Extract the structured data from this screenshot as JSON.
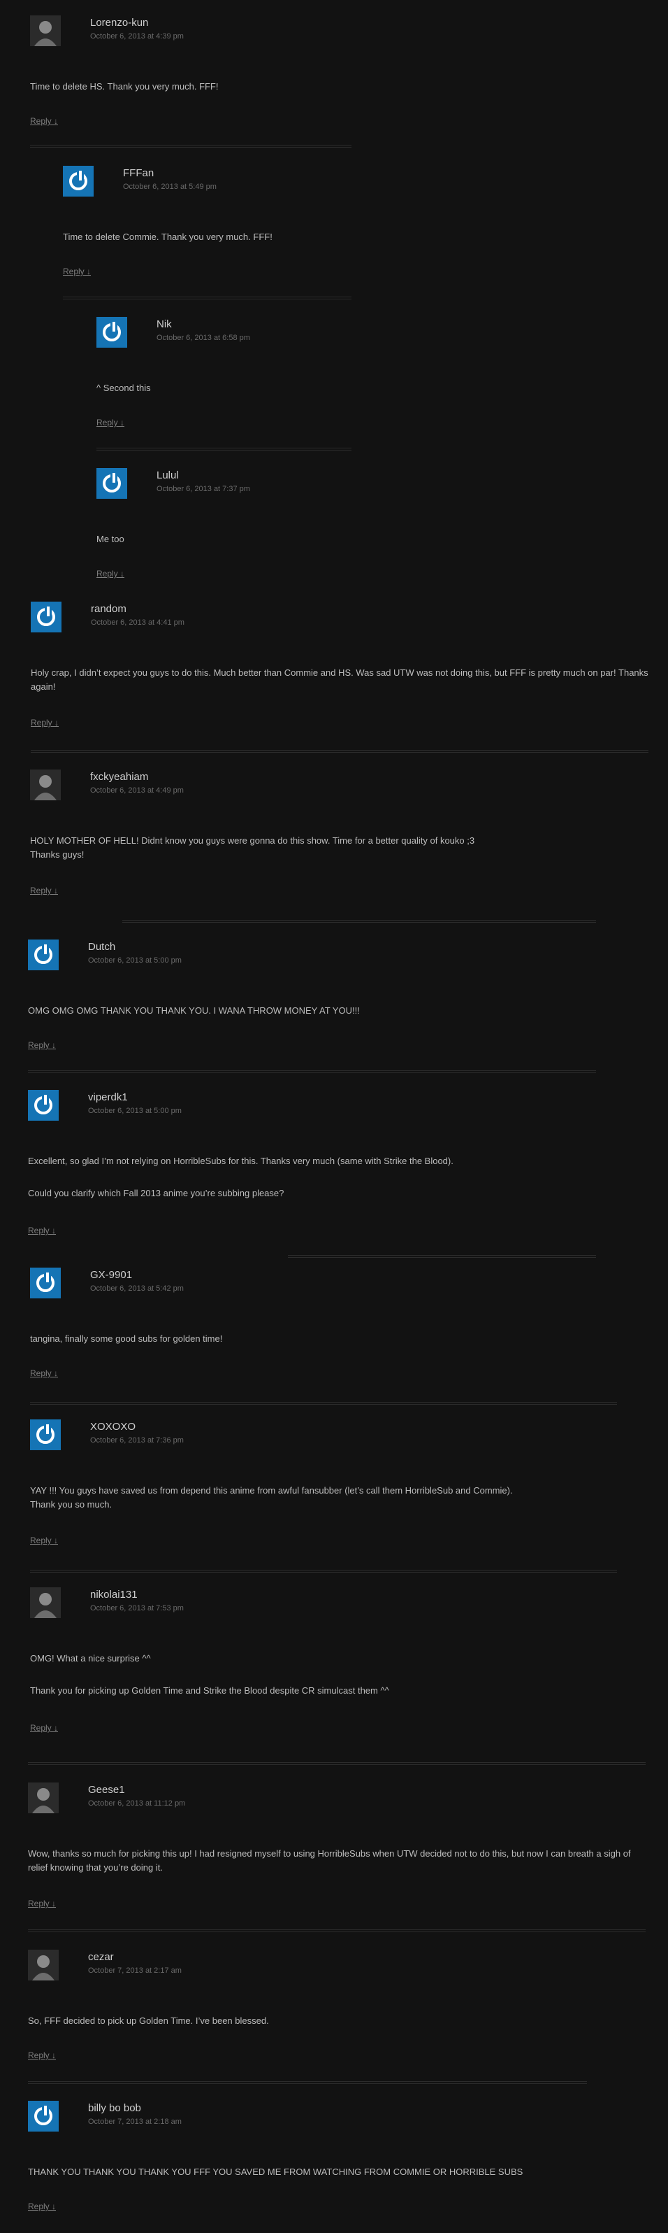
{
  "reply_label": "Reply ↓",
  "comments": [
    {
      "author": "Lorenzo-kun",
      "date": "October 6, 2013 at 4:39 pm",
      "paragraphs": [
        "Time to delete HS. Thank you very much. FFF!"
      ]
    },
    {
      "author": "FFFan",
      "date": "October 6, 2013 at 5:49 pm",
      "paragraphs": [
        "Time to delete Commie. Thank you very much. FFF!"
      ]
    },
    {
      "author": "Nik",
      "date": "October 6, 2013 at 6:58 pm",
      "paragraphs": [
        "^ Second this"
      ]
    },
    {
      "author": "Lulul",
      "date": "October 6, 2013 at 7:37 pm",
      "paragraphs": [
        "Me too"
      ]
    },
    {
      "author": "random",
      "date": "October 6, 2013 at 4:41 pm",
      "paragraphs": [
        "Holy crap, I didn’t expect you guys to do this. Much better than Commie and HS. Was sad UTW was not doing this, but FFF is pretty much on par! Thanks again!"
      ]
    },
    {
      "author": "fxckyeahiam",
      "date": "October 6, 2013 at 4:49 pm",
      "paragraphs": [
        "HOLY MOTHER OF HELL! Didnt know you guys were gonna do this show. Time for a better quality of kouko ;3\nThanks guys!"
      ]
    },
    {
      "author": "Dutch",
      "date": "October 6, 2013 at 5:00 pm",
      "paragraphs": [
        "OMG OMG OMG THANK YOU THANK YOU. I WANA THROW MONEY AT YOU!!!"
      ]
    },
    {
      "author": "viperdk1",
      "date": "October 6, 2013 at 5:00 pm",
      "paragraphs": [
        "Excellent, so glad I’m not relying on HorribleSubs for this. Thanks very much (same with Strike the Blood).",
        "Could you clarify which Fall 2013 anime you’re subbing please?"
      ]
    },
    {
      "author": "GX-9901",
      "date": "October 6, 2013 at 5:42 pm",
      "paragraphs": [
        "tangina, finally some good subs for golden time!"
      ]
    },
    {
      "author": "XOXOXO",
      "date": "October 6, 2013 at 7:36 pm",
      "paragraphs": [
        "YAY !!! You guys have saved us from depend this anime from awful fansubber (let’s call them HorribleSub and Commie).\nThank you so much."
      ]
    },
    {
      "author": "nikolai131",
      "date": "October 6, 2013 at 7:53 pm",
      "paragraphs": [
        "OMG! What a nice surprise ^^",
        "Thank you for picking up Golden Time and Strike the Blood despite CR simulcast them ^^"
      ]
    },
    {
      "author": "Geese1",
      "date": "October 6, 2013 at 11:12 pm",
      "paragraphs": [
        "Wow, thanks so much for picking this up! I had resigned myself to using HorribleSubs when UTW decided not to do this, but now I can breath a sigh of relief knowing that you’re doing it."
      ]
    },
    {
      "author": "cezar",
      "date": "October 7, 2013 at 2:17 am",
      "paragraphs": [
        "So, FFF decided to pick up Golden Time. I’ve been blessed."
      ]
    },
    {
      "author": "billy bo bob",
      "date": "October 7, 2013 at 2:18 am",
      "paragraphs": [
        "THANK YOU THANK YOU THANK YOU FFF YOU SAVED ME FROM WATCHING FROM COMMIE OR HORRIBLE SUBS"
      ]
    }
  ]
}
